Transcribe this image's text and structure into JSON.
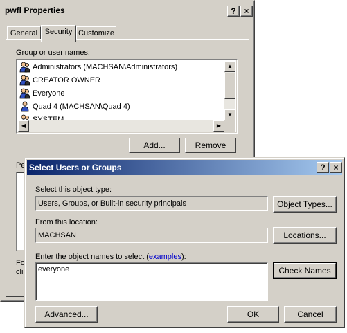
{
  "properties_window": {
    "title": "pwfl Properties",
    "help_btn": "?",
    "close_btn": "×",
    "tabs": [
      {
        "label": "General"
      },
      {
        "label": "Security",
        "active": true
      },
      {
        "label": "Customize"
      }
    ],
    "group_label": "Group or user names:",
    "users": [
      {
        "name": "Administrators (MACHSAN\\Administrators)",
        "selected": true
      },
      {
        "name": "CREATOR OWNER"
      },
      {
        "name": "Everyone"
      },
      {
        "name": "Quad 4 (MACHSAN\\Quad 4)"
      },
      {
        "name": "SYSTEM"
      }
    ],
    "add_button": "Add...",
    "remove_button": "Remove",
    "perm_label_partial": "Pe",
    "for_text_partial": "Fo",
    "click_text_partial": "cli"
  },
  "select_dialog": {
    "title": "Select Users or Groups",
    "help_btn": "?",
    "close_btn": "×",
    "object_type_label": "Select this object type:",
    "object_type_value": "Users, Groups, or Built-in security principals",
    "object_types_button": "Object Types...",
    "location_label": "From this location:",
    "location_value": "MACHSAN",
    "locations_button": "Locations...",
    "enter_names_label_pre": "Enter the object names to select (",
    "examples_link": "examples",
    "enter_names_label_post": "):",
    "names_value": "everyone",
    "check_names_button": "Check Names",
    "advanced_button": "Advanced...",
    "ok_button": "OK",
    "cancel_button": "Cancel"
  },
  "colors": {
    "face": "#d4d0c8",
    "selection": "#ffffff",
    "link": "#0000cc"
  }
}
